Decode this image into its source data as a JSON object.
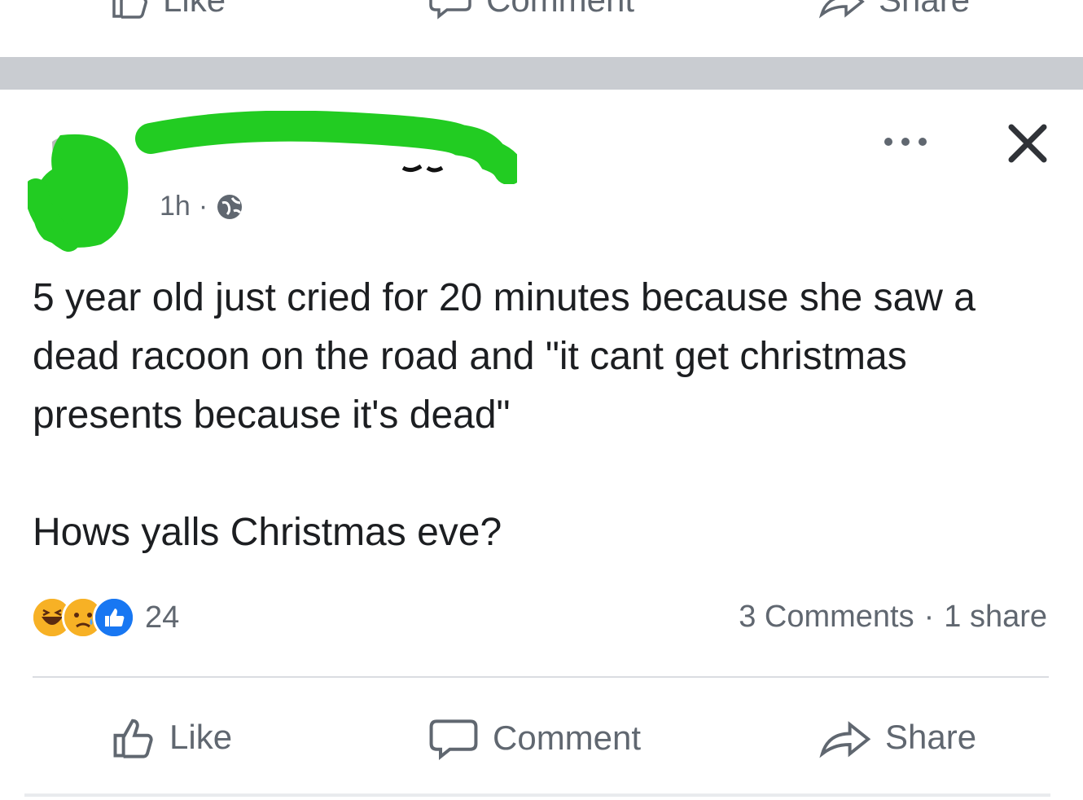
{
  "previous_post": {
    "actions": [
      {
        "label": "Like",
        "icon": "thumbs-up-icon"
      },
      {
        "label": "Comment",
        "icon": "comment-icon"
      },
      {
        "label": "Share",
        "icon": "share-icon"
      }
    ]
  },
  "post": {
    "time": "1h",
    "meta_separator": "·",
    "privacy_icon": "globe-icon",
    "body": [
      "5 year old just cried for 20 minutes because she saw a dead racoon on the road and \"it cant get christmas presents because it's dead\"",
      "Hows yalls Christmas eve?"
    ],
    "reactions": {
      "types": [
        "haha",
        "sad",
        "like"
      ],
      "count": "24"
    },
    "stats": {
      "comments": "3 Comments",
      "separator": "·",
      "shares": "1 share"
    },
    "actions": [
      {
        "label": "Like",
        "icon": "thumbs-up-icon"
      },
      {
        "label": "Comment",
        "icon": "comment-icon"
      },
      {
        "label": "Share",
        "icon": "share-icon"
      }
    ]
  },
  "colors": {
    "text": "#1c1e21",
    "secondary": "#606770",
    "separator": "#c9ccd1",
    "redaction": "#22cc22",
    "like_blue": "#1877f2",
    "emoji_yellow": "#f7b125"
  }
}
